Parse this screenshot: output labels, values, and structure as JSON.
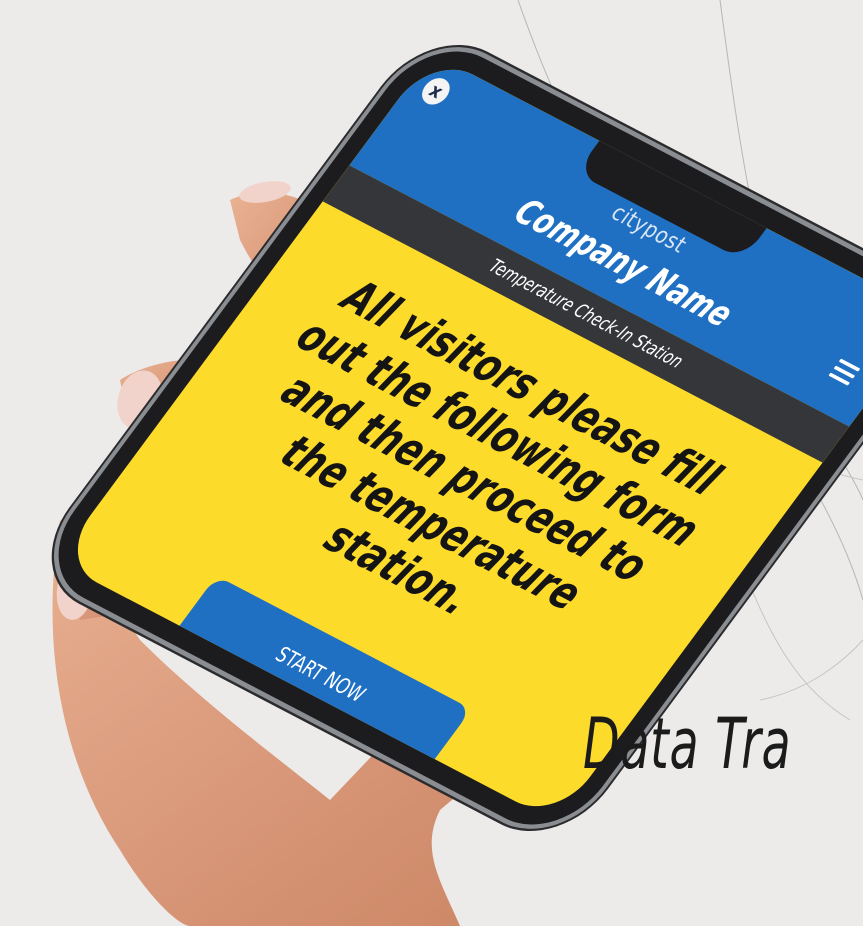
{
  "app": {
    "logo_text": "citypost",
    "close_icon": "x",
    "company_name": "Company Name",
    "subtitle": "Temperature Check-In Station",
    "message": "All visitors please fill out the following form and then proceed to the temperature station.",
    "button_label": "START NOW",
    "menu_icon": "hamburger-menu-icon"
  },
  "page": {
    "tagline": "Data Tra"
  },
  "colors": {
    "header_blue": "#1f6fc3",
    "subheader_dark": "#35363a",
    "screen_yellow": "#fddb2a",
    "background": "#ecebea"
  }
}
